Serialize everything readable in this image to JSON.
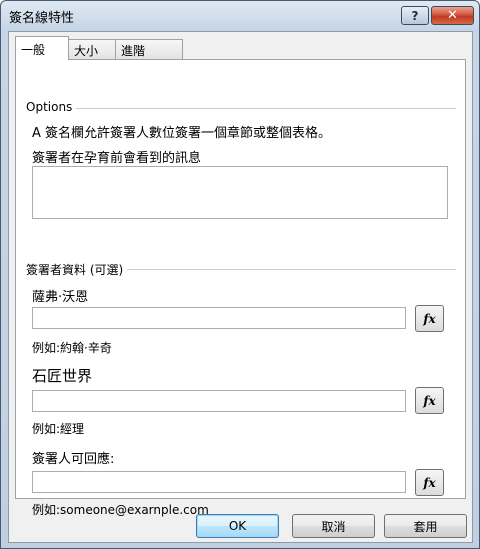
{
  "window": {
    "title": "簽名線特性",
    "help_label": "?",
    "close_label": "✕"
  },
  "tabs": [
    {
      "label": "一般",
      "active": true
    },
    {
      "label": "大小",
      "active": false
    },
    {
      "label": "進階",
      "active": false
    }
  ],
  "options_group": {
    "label": "Options",
    "description": "A 簽名欄允許簽署人數位簽署一個章節或整個表格。",
    "message_label": "簽署者在孕育前會看到的訊息",
    "message_value": ""
  },
  "signer_group": {
    "label": "簽署者資料 (可選)",
    "fields": [
      {
        "label": "薩弗·沃恩",
        "value": "",
        "example": "例如:約翰·辛奇"
      },
      {
        "label": "石匠世界",
        "value": "",
        "example": "例如:經理"
      },
      {
        "label": "簽署人可回應:",
        "value": "",
        "example": "例如:someone@exarnple.com"
      }
    ],
    "fx_label": "fx"
  },
  "buttons": {
    "ok": "OK",
    "cancel": "取消",
    "apply": "套用"
  },
  "colors": {
    "title_gradient_top": "#dfe9f3",
    "close_button": "#c03a20",
    "default_button_border": "#3c7fb1"
  },
  "icons": {
    "help": "question-mark-icon",
    "close": "close-icon",
    "formula": "fx-icon"
  }
}
